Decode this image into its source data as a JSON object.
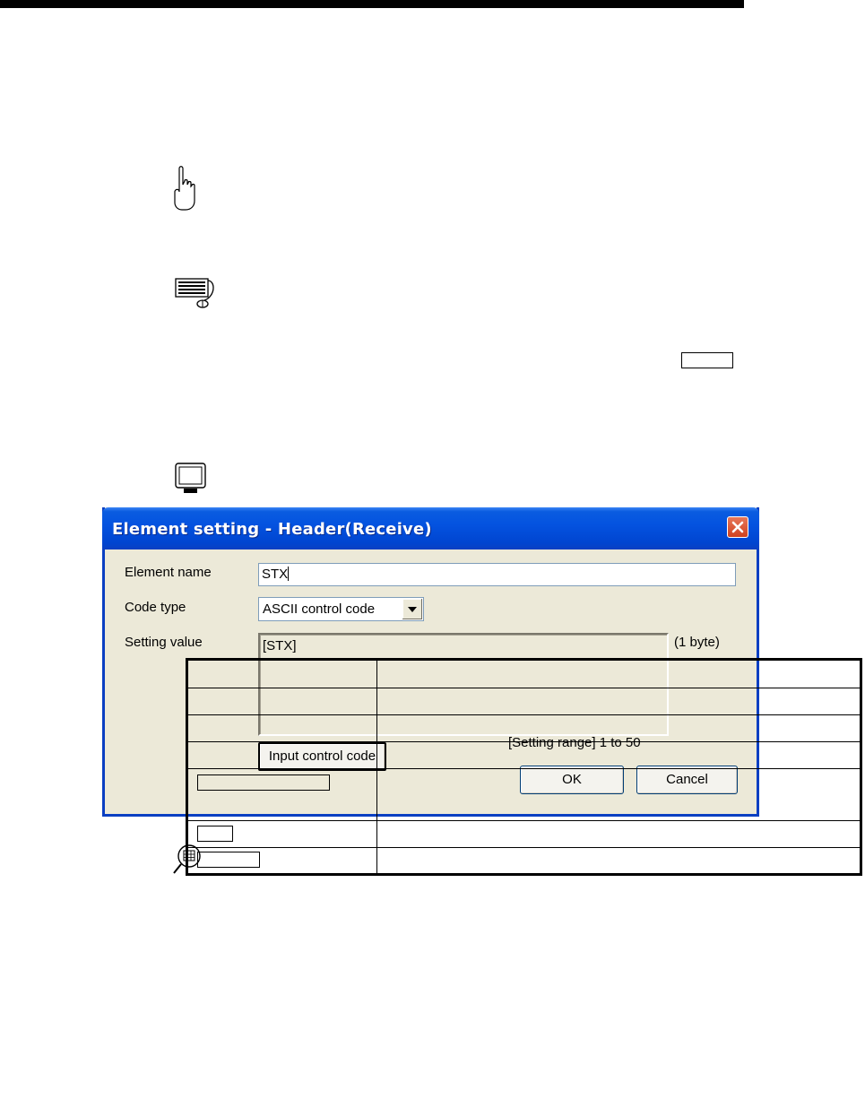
{
  "dialog": {
    "title": "Element setting - Header(Receive)",
    "labels": {
      "element_name": "Element name",
      "code_type": "Code type",
      "setting_value": "Setting value"
    },
    "element_name_value": "STX",
    "code_type_selected": "ASCII control code",
    "setting_value_text": "[STX]",
    "byte_count": "(1 byte)",
    "setting_range": "[Setting range] 1 to 50",
    "buttons": {
      "input_control_code": "Input control code",
      "ok": "OK",
      "cancel": "Cancel"
    }
  },
  "icons": [
    "hand-pointer-icon",
    "keyboard-icon",
    "monitor-icon",
    "magnifier-icon",
    "close-icon"
  ],
  "colors": {
    "titlebar": "#0453e0",
    "dialog_bg": "#ece9d8",
    "close": "#d1411e"
  }
}
